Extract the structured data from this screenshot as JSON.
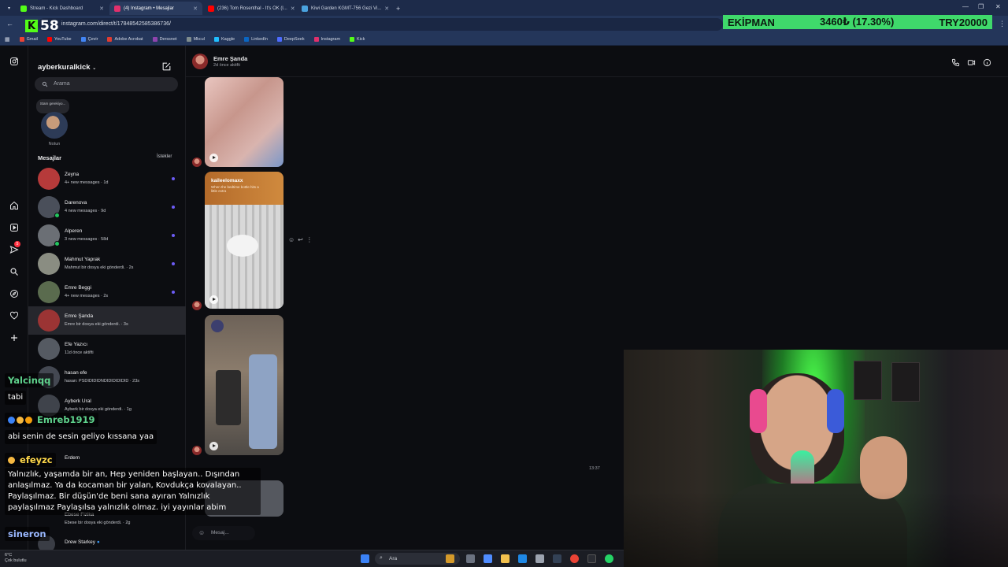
{
  "browser": {
    "tabs": [
      {
        "label": "Stream - Kick Dashboard",
        "color": "#53fc18",
        "active": false
      },
      {
        "label": "(4) Instagram • Mesajlar",
        "color": "#e1306c",
        "active": true
      },
      {
        "label": "(236) Tom Rosenthal - It's OK (l...",
        "color": "#ff0000",
        "active": false
      },
      {
        "label": "Kiwi Garden KGMT-756 Gezi Vi...",
        "color": "#4aa3df",
        "active": false
      }
    ],
    "new_tab": "+",
    "url": "instagram.com/direct/t/17848542585386736/",
    "kick_logo_text": "58",
    "bookmarks": [
      {
        "label": "Gmail",
        "color": "#ea4335"
      },
      {
        "label": "YouTube",
        "color": "#ff0000"
      },
      {
        "label": "Çevir",
        "color": "#4285f4"
      },
      {
        "label": "Adobe Acrobat",
        "color": "#e03c31"
      },
      {
        "label": "Derssnet",
        "color": "#8e44ad"
      },
      {
        "label": "Mkcul",
        "color": "#7f8c8d"
      },
      {
        "label": "Kaggle",
        "color": "#20beff"
      },
      {
        "label": "LinkedIn",
        "color": "#0a66c2"
      },
      {
        "label": "DeepSeek",
        "color": "#4d6bfe"
      },
      {
        "label": "Instagram",
        "color": "#e1306c"
      },
      {
        "label": "Kick",
        "color": "#53fc18"
      }
    ]
  },
  "ticker": {
    "name": "EKİPMAN",
    "value": "3460₺ (17.30%)",
    "goal": "TRY20000"
  },
  "instagram": {
    "username": "ayberkuralkick",
    "search_placeholder": "Arama",
    "note_text": "Stam gerekiyo...",
    "note_label": "Notun",
    "messages_heading": "Mesajlar",
    "requests_label": "İstekler",
    "notification_count": "5",
    "conversations": [
      {
        "name": "Zeyna",
        "sub": "4+ new messages · 1d",
        "unread": true,
        "online": false,
        "color": "#b63a3a"
      },
      {
        "name": "Darenova",
        "sub": "4 new messages · 9d",
        "unread": true,
        "online": true,
        "color": "#4a4f5a"
      },
      {
        "name": "Alperen",
        "sub": "3 new messages · 58d",
        "unread": true,
        "online": true,
        "color": "#6b6f75"
      },
      {
        "name": "Mahmut Yaprak",
        "sub": "Mahmut bir dosya eki gönderdi. · 2s",
        "unread": true,
        "online": false,
        "color": "#8a8d82"
      },
      {
        "name": "Emre Beggi",
        "sub": "4+ new messages · 2s",
        "unread": true,
        "online": false,
        "color": "#5a6b4e"
      },
      {
        "name": "Emre Şanda",
        "sub": "Emre bir dosya eki gönderdi. · 3s",
        "unread": false,
        "online": false,
        "color": "#9b3434",
        "selected": true
      },
      {
        "name": "Efe Yazıcı",
        "sub": "11d önce aktifti",
        "unread": false,
        "online": false,
        "color": "#555a62"
      },
      {
        "name": "hasan efe",
        "sub": "hasan: PSDIDIDIDNDIDIDIDIDID · 23s",
        "unread": false,
        "online": false,
        "color": "#444852"
      },
      {
        "name": "Ayberk Ural",
        "sub": "Ayberk bir dosya eki gönderdi. · 1g",
        "unread": false,
        "online": false,
        "color": "#3f434b"
      }
    ],
    "lower_rows": [
      {
        "name": "Erdem",
        "sub": ""
      },
      {
        "name": "Ebese Fizika",
        "sub": "Ebese bir dosya eki gönderdi. · 2g"
      },
      {
        "name": "Drew Starkey",
        "sub": ""
      }
    ],
    "chat": {
      "name": "Emre Şanda",
      "status": "2d önce aktifti",
      "reel_caption_user": "kaileelomaxx",
      "reel_caption_text": "When the bedtime bottle hits a little extra",
      "timestamp": "13:37",
      "input_placeholder": "Mesaj..."
    }
  },
  "stream_chat": [
    {
      "user": "Yalcinqq",
      "user_color": "#5fd38d",
      "text": "tabi"
    },
    {
      "user": "Emreb1919",
      "user_color": "#5fd38d",
      "text": "abi senin de sesin geliyo kıssana yaa"
    },
    {
      "user": "efeyzc",
      "user_color": "#ffd84a",
      "text": "Yalnızlık, yaşamda bir an, Hep yeniden başlayan.. Dışından anlaşılmaz. Ya da kocaman bir yalan, Kovdukça kovalayan.. Paylaşılmaz. Bir düşün'de beni sana ayıran Yalnızlık paylaşılmaz Paylaşılsa yalnızlık olmaz. iyi yayınlar abim"
    },
    {
      "user": "sineron",
      "user_color": "#9ab8ff",
      "text": ""
    }
  ],
  "taskbar": {
    "temp": "6°C",
    "weather": "Çok bulutlu",
    "search": "Ara"
  }
}
